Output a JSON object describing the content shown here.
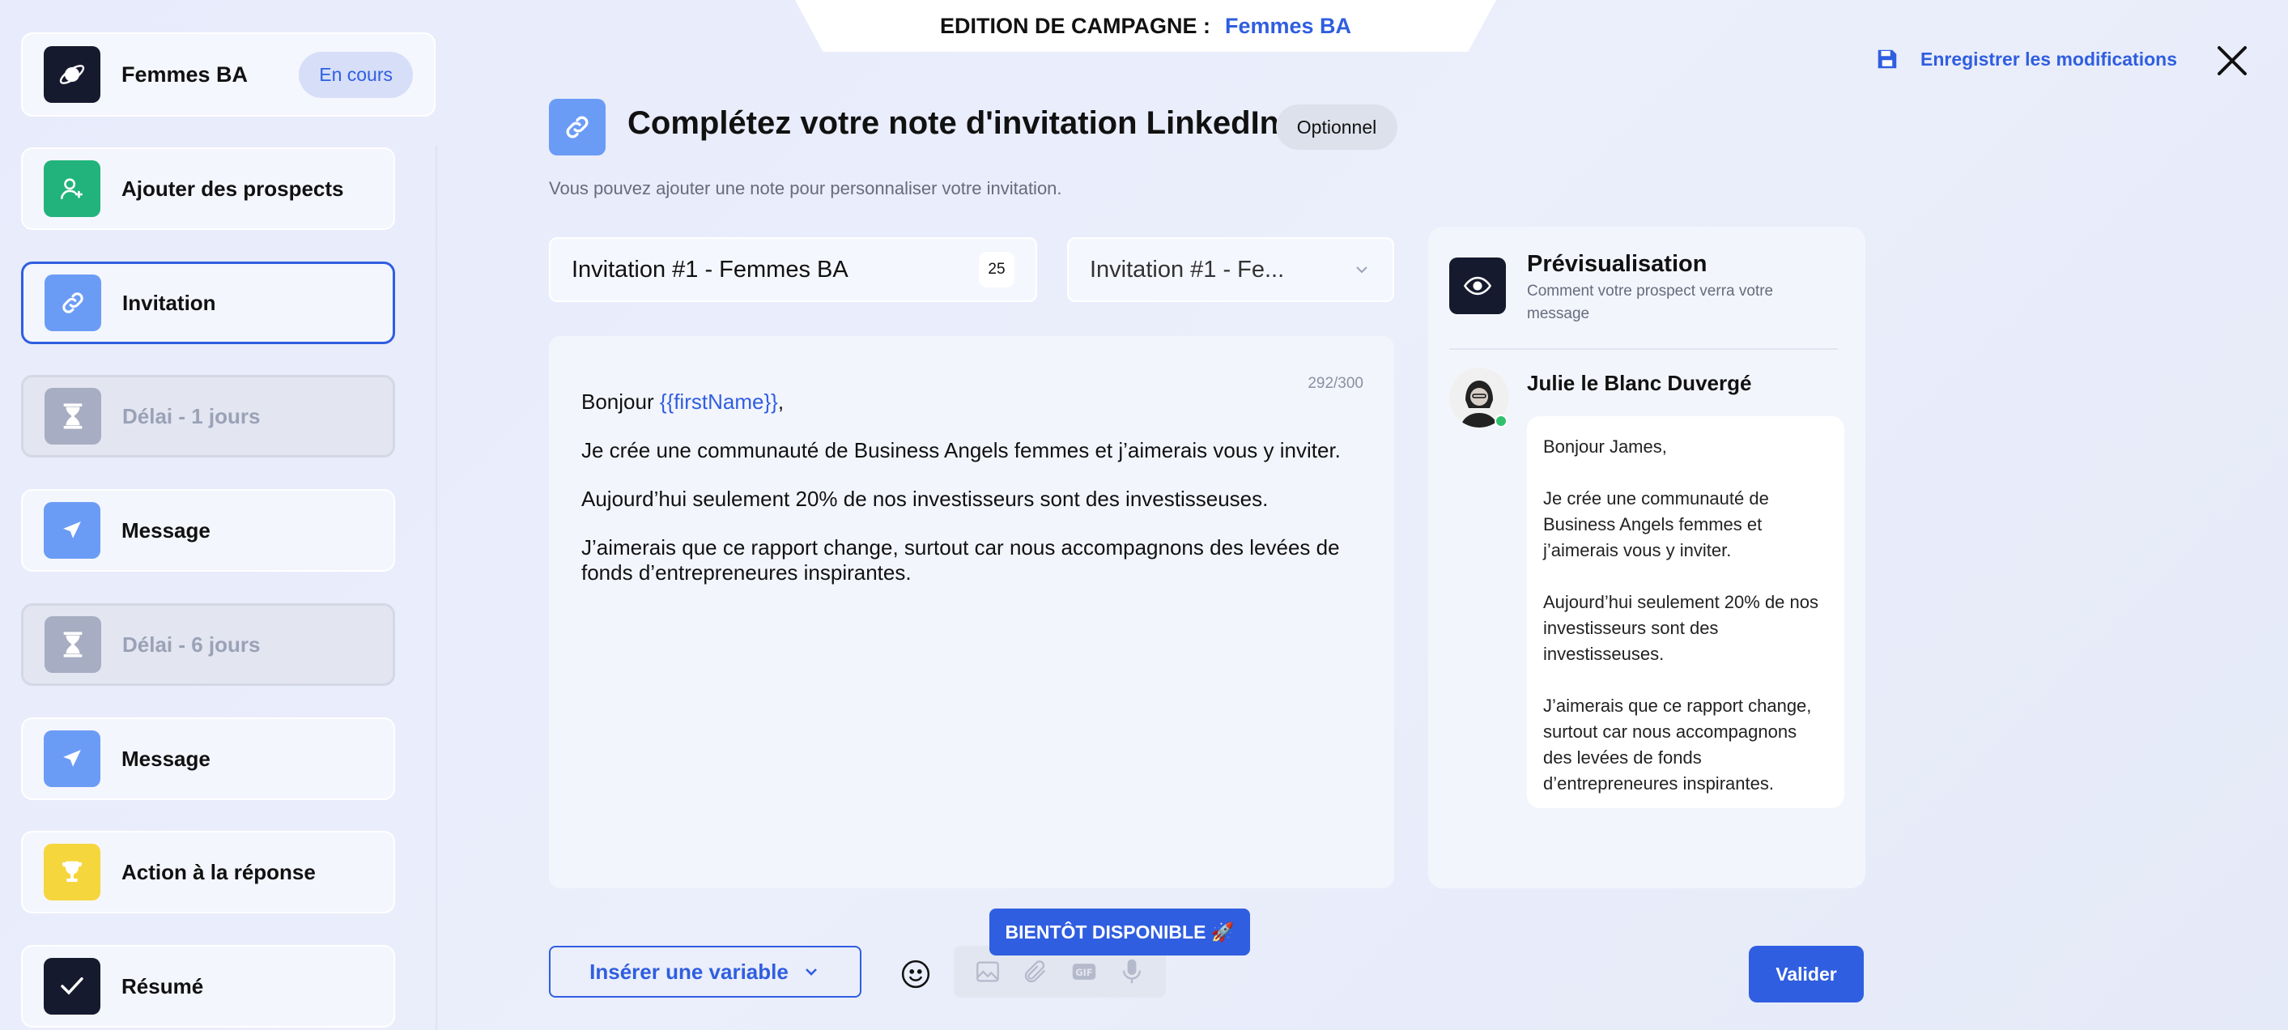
{
  "header": {
    "edition_label": "EDITION DE CAMPAGNE :",
    "campaign_name": "Femmes BA",
    "save_label": "Enregistrer les modifications"
  },
  "campaign": {
    "name": "Femmes BA",
    "status": "En cours"
  },
  "steps": [
    {
      "label": "Ajouter des prospects",
      "icon": "add-user-icon",
      "color": "#21b37b"
    },
    {
      "label": "Invitation",
      "icon": "link-icon",
      "color": "#6b9cf5",
      "active": true
    },
    {
      "label": "Délai - 1 jours",
      "icon": "hourglass-icon",
      "color": "#a7adc2",
      "muted": true
    },
    {
      "label": "Message",
      "icon": "send-icon",
      "color": "#6b9cf5"
    },
    {
      "label": "Délai - 6 jours",
      "icon": "hourglass-icon",
      "color": "#a7adc2",
      "muted": true
    },
    {
      "label": "Message",
      "icon": "send-icon",
      "color": "#6b9cf5"
    },
    {
      "label": "Action à la réponse",
      "icon": "trophy-icon",
      "color": "#f5d63d"
    },
    {
      "label": "Résumé",
      "icon": "check-icon",
      "color": "#161a2e"
    }
  ],
  "main": {
    "title": "Complétez votre note d'invitation LinkedIn",
    "optional_badge": "Optionnel",
    "subtitle": "Vous pouvez ajouter une note pour personnaliser votre invitation.",
    "name_input_value": "Invitation #1 - Femmes BA",
    "name_char_count": "25",
    "template_select_value": "Invitation #1 - Fe...",
    "char_counter": "292/300",
    "message": {
      "greeting": "Bonjour ",
      "variable": "{{firstName}}",
      "greeting_end": ",",
      "p1": "Je crée une communauté de Business Angels femmes et j’aimerais vous y inviter.",
      "p2": "Aujourd’hui seulement 20% de nos investisseurs sont des investisseuses.",
      "p3": "J’aimerais que ce rapport change, surtout car nous accompagnons des levées de fonds d’entrepreneures inspirantes."
    }
  },
  "preview": {
    "title": "Prévisualisation",
    "subtitle": "Comment votre prospect verra votre message",
    "sender_name": "Julie le Blanc Duvergé",
    "bubble": {
      "greeting": "Bonjour James,",
      "p1": "Je crée une communauté de Business Angels femmes et j’aimerais vous y inviter.",
      "p2": "Aujourd’hui seulement 20% de nos investisseurs sont des investisseuses.",
      "p3": "J’aimerais que ce rapport change, surtout car nous accompagnons des levées de fonds d’entrepreneures inspirantes."
    }
  },
  "footer": {
    "insert_variable_label": "Insérer une variable",
    "coming_soon_label": "BIENTÔT DISPONIBLE 🚀",
    "validate_label": "Valider"
  }
}
